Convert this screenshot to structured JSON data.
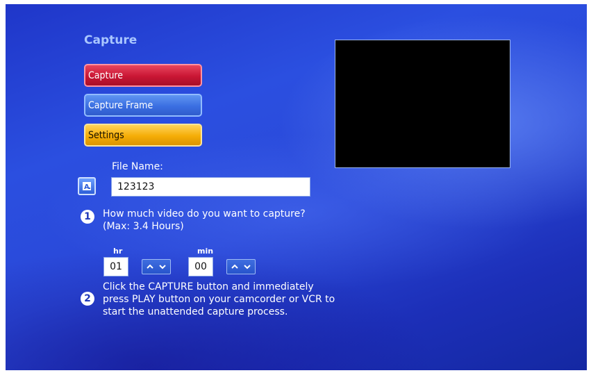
{
  "header": {
    "title": "Capture"
  },
  "menu": {
    "capture_label": "Capture",
    "capture_frame_label": "Capture Frame",
    "settings_label": "Settings"
  },
  "file_name": {
    "label": "File Name:",
    "value": "123123",
    "keyboard_icon": "keyboard-icon"
  },
  "step1": {
    "number": "1",
    "text": "How much video do you want to capture? (Max: 3.4 Hours)",
    "hr_label": "hr",
    "hr_value": "01",
    "min_label": "min",
    "min_value": "00"
  },
  "step2": {
    "number": "2",
    "text": "Click the CAPTURE button and immediately press PLAY button on your camcorder or VCR to start the unattended capture process."
  },
  "colors": {
    "background": "#2a48d8",
    "capture_button": "#c91634",
    "capture_frame_button": "#3b6fe2",
    "settings_button": "#f5ad06",
    "title_text": "#a9c6ff"
  }
}
